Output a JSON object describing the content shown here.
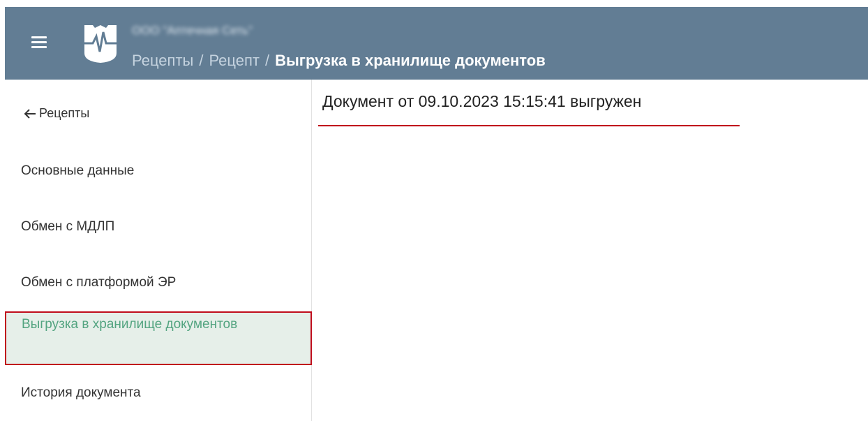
{
  "header": {
    "org_name": "ООО \"Аптечная Сеть\"",
    "breadcrumb": {
      "item1": "Рецепты",
      "item2": "Рецепт",
      "separator": "/",
      "current": "Выгрузка в хранилище документов"
    },
    "icons": {
      "menu": "hamburger-menu-icon",
      "logo": "pharmacy-logo-icon"
    },
    "colors": {
      "background": "#627d94",
      "current_text": "#ffffff"
    }
  },
  "sidebar": {
    "back_label": "Рецепты",
    "items": [
      {
        "label": "Основные данные"
      },
      {
        "label": "Обмен с МДЛП"
      },
      {
        "label": "Обмен с платформой ЭР"
      },
      {
        "label": "Выгрузка в хранилище документов",
        "active": true
      },
      {
        "label": "История документа"
      }
    ],
    "colors": {
      "active_bg": "#e6efe9",
      "active_text": "#53a480",
      "highlight_border": "#c00c1c"
    }
  },
  "main": {
    "status_text": "Документ от 09.10.2023 15:15:41 выгружен",
    "colors": {
      "underline": "#c00c1c"
    }
  }
}
